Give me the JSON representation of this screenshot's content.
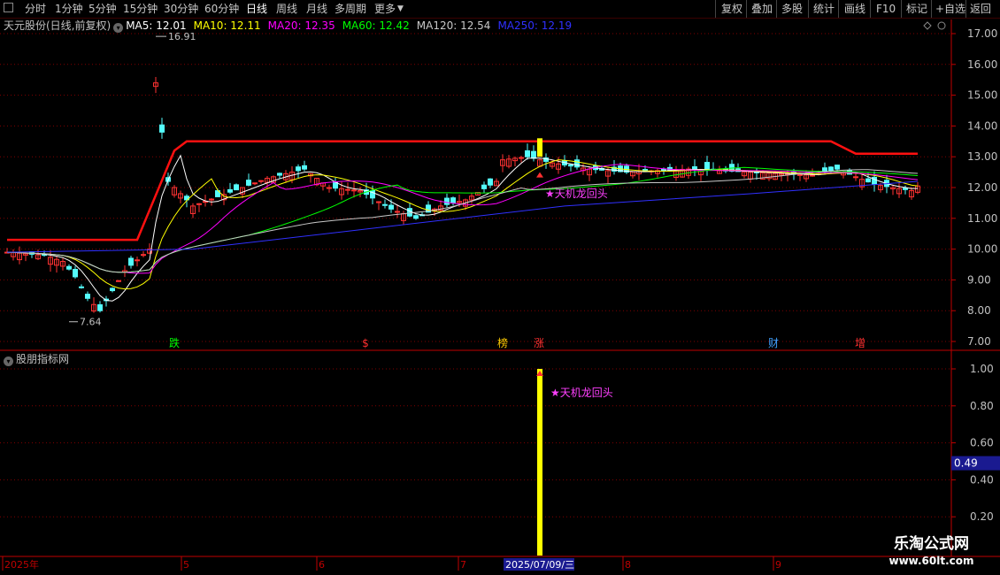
{
  "toolbar": {
    "left": [
      "分时",
      "1分钟",
      "5分钟",
      "15分钟",
      "30分钟",
      "60分钟",
      "日线",
      "周线",
      "月线",
      "多周期",
      "更多"
    ],
    "active": "日线",
    "more_arrow": "▼",
    "right": [
      "复权",
      "叠加",
      "多股",
      "统计",
      "画线",
      "F10",
      "标记",
      "+自选",
      "返回"
    ]
  },
  "main": {
    "stock": "天元股份(日线,前复权)",
    "ma": [
      {
        "label": "MA5: 12.01",
        "color": "#ffffff"
      },
      {
        "label": "MA10: 12.11",
        "color": "#ffff00"
      },
      {
        "label": "MA20: 12.35",
        "color": "#ff00ff"
      },
      {
        "label": "MA60: 12.42",
        "color": "#00ff00"
      },
      {
        "label": "MA120: 12.54",
        "color": "#c8c8c8"
      },
      {
        "label": "MA250: 12.19",
        "color": "#3030ff"
      }
    ],
    "y_ticks": [
      "17.00",
      "16.00",
      "15.00",
      "14.00",
      "13.00",
      "12.00",
      "11.00",
      "10.00",
      "9.00",
      "8.00",
      "7.00"
    ],
    "high_label": "16.91",
    "low_label": "7.64",
    "signal_label": "★天机龙回头",
    "markers": [
      {
        "text": "跌",
        "color": "#00ff00"
      },
      {
        "text": "$",
        "color": "#ff3030"
      },
      {
        "text": "榜",
        "color": "#ffcc00"
      },
      {
        "text": "涨",
        "color": "#ff3030"
      },
      {
        "text": "财",
        "color": "#40a0ff"
      },
      {
        "text": "增",
        "color": "#ff3030"
      }
    ]
  },
  "sub": {
    "title": "股朋指标网",
    "y_ticks": [
      "1.00",
      "0.80",
      "0.60",
      "0.40",
      "0.20"
    ],
    "value_box": "0.49",
    "signal_label": "★天机龙回头"
  },
  "date_axis": {
    "labels": [
      "2025年",
      "5",
      "6",
      "7",
      "2025/07/09/三",
      "8",
      "9"
    ]
  },
  "watermark": {
    "line1": "乐淘公式网",
    "line2": "www.60lt.com"
  },
  "colors": {
    "up": "#ff3232",
    "down": "#54fcfc",
    "grid": "#800000",
    "axis": "#c00000",
    "resistance": "#ff1010",
    "signal": "#ffff00",
    "label": "#ff40ff"
  }
}
